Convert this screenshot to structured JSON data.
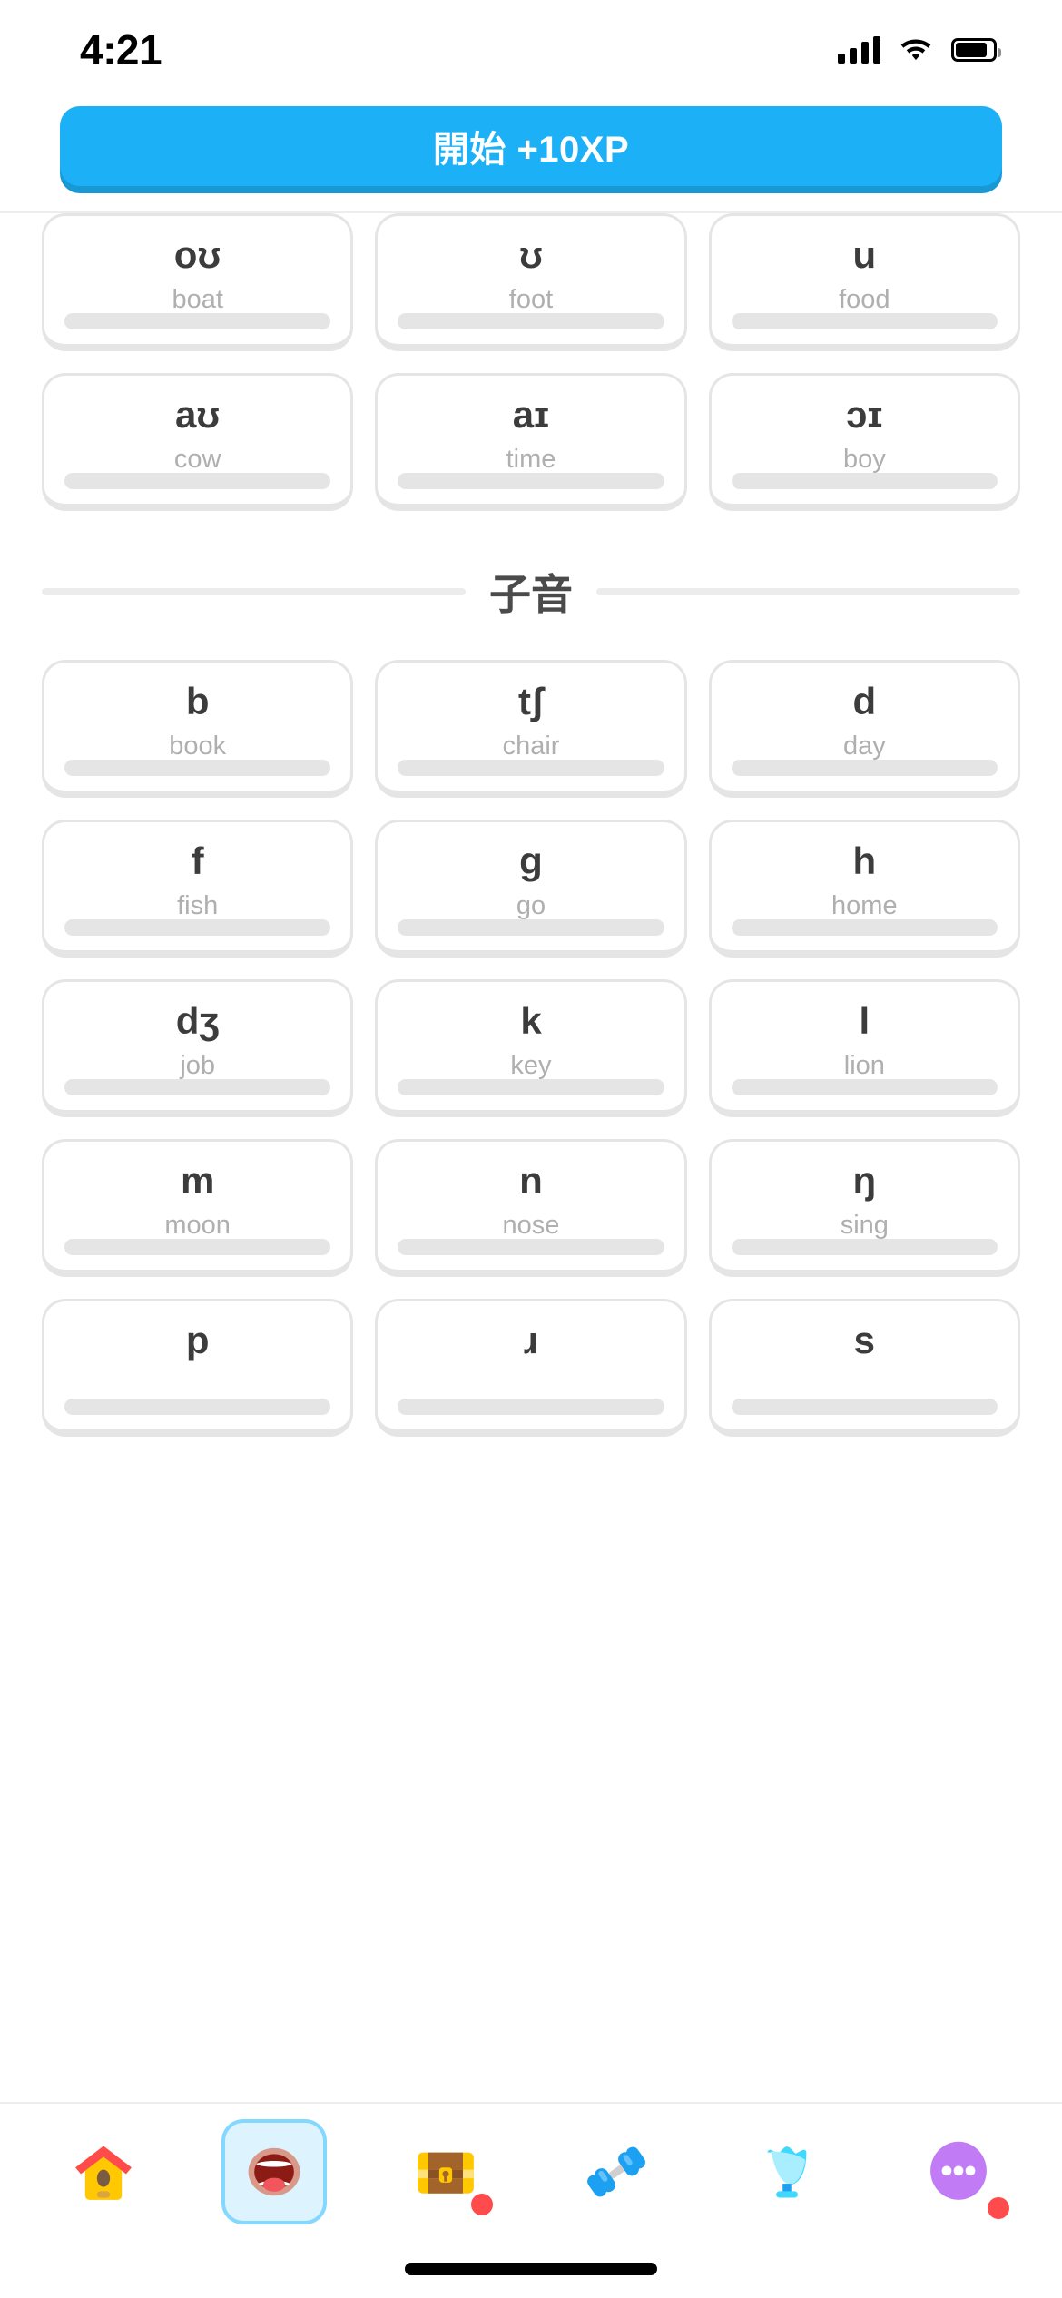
{
  "status_bar": {
    "time": "4:21",
    "signal_icon": "cellular-signal-icon",
    "wifi_icon": "wifi-icon",
    "battery_icon": "battery-icon"
  },
  "cta": {
    "label": "開始 +10XP",
    "color": "#1CB0F6",
    "shadow_color": "#1899D6"
  },
  "sections": [
    {
      "id": "vowels",
      "heading": null,
      "rows": [
        [
          {
            "ipa": "oʊ",
            "word": "boat"
          },
          {
            "ipa": "ʊ",
            "word": "foot"
          },
          {
            "ipa": "u",
            "word": "food"
          }
        ],
        [
          {
            "ipa": "aʊ",
            "word": "cow"
          },
          {
            "ipa": "aɪ",
            "word": "time"
          },
          {
            "ipa": "ɔɪ",
            "word": "boy"
          }
        ]
      ]
    },
    {
      "id": "consonants",
      "heading": "子音",
      "rows": [
        [
          {
            "ipa": "b",
            "word": "book"
          },
          {
            "ipa": "tʃ",
            "word": "chair"
          },
          {
            "ipa": "d",
            "word": "day"
          }
        ],
        [
          {
            "ipa": "f",
            "word": "fish"
          },
          {
            "ipa": "g",
            "word": "go"
          },
          {
            "ipa": "h",
            "word": "home"
          }
        ],
        [
          {
            "ipa": "dʒ",
            "word": "job"
          },
          {
            "ipa": "k",
            "word": "key"
          },
          {
            "ipa": "l",
            "word": "lion"
          }
        ],
        [
          {
            "ipa": "m",
            "word": "moon"
          },
          {
            "ipa": "n",
            "word": "nose"
          },
          {
            "ipa": "ŋ",
            "word": "sing"
          }
        ],
        [
          {
            "ipa": "p",
            "word": ""
          },
          {
            "ipa": "ɹ",
            "word": ""
          },
          {
            "ipa": "s",
            "word": ""
          }
        ]
      ]
    }
  ],
  "tabbar": {
    "items": [
      {
        "id": "home",
        "icon": "house-icon",
        "active": false,
        "badge": false
      },
      {
        "id": "practice",
        "icon": "mouth-icon",
        "active": true,
        "badge": false
      },
      {
        "id": "treasure",
        "icon": "treasure-chest-icon",
        "active": false,
        "badge": true
      },
      {
        "id": "workout",
        "icon": "dumbbell-icon",
        "active": false,
        "badge": false
      },
      {
        "id": "trophy",
        "icon": "trophy-icon",
        "active": false,
        "badge": false
      },
      {
        "id": "more",
        "icon": "ellipsis-bubble-icon",
        "active": false,
        "badge": true
      }
    ],
    "badge_color": "#FF4B4B",
    "active_bg": "#DDF4FF",
    "active_border": "#84D8FF"
  }
}
